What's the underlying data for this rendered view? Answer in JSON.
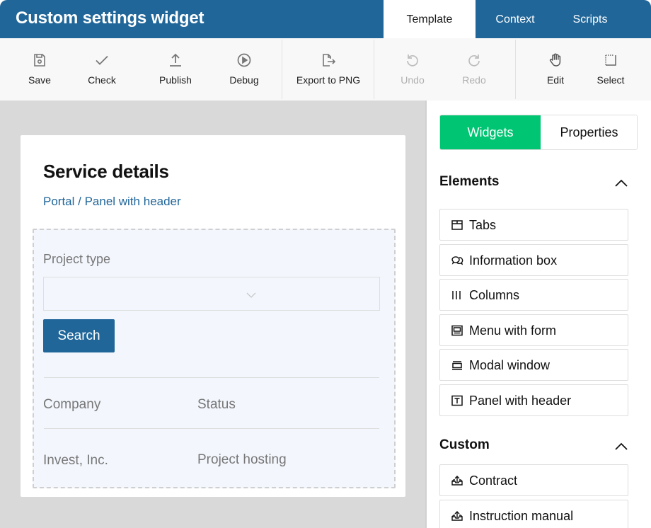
{
  "header": {
    "title": "Custom settings widget",
    "tabs": [
      {
        "label": "Template",
        "active": true
      },
      {
        "label": "Context",
        "active": false
      },
      {
        "label": "Scripts",
        "active": false
      }
    ]
  },
  "toolbar": {
    "items": [
      {
        "label": "Save",
        "icon": "save-icon",
        "enabled": true
      },
      {
        "label": "Check",
        "icon": "check-icon",
        "enabled": true
      },
      {
        "label": "Publish",
        "icon": "upload-icon",
        "enabled": true
      },
      {
        "label": "Debug",
        "icon": "play-circle-icon",
        "enabled": true
      },
      {
        "label": "Export to PNG",
        "icon": "export-icon",
        "enabled": true
      },
      {
        "label": "Undo",
        "icon": "undo-icon",
        "enabled": false
      },
      {
        "label": "Redo",
        "icon": "redo-icon",
        "enabled": false
      },
      {
        "label": "Edit",
        "icon": "hand-icon",
        "enabled": true
      },
      {
        "label": "Select",
        "icon": "select-area-icon",
        "enabled": true
      }
    ]
  },
  "canvas": {
    "panel_title": "Service details",
    "breadcrumb": "Portal / Panel with header",
    "form": {
      "field_label": "Project type",
      "select_value": "",
      "search_button": "Search"
    },
    "table": {
      "columns": [
        "Company",
        "Status"
      ],
      "rows": [
        [
          "Invest, Inc.",
          "Project hosting"
        ]
      ]
    }
  },
  "sidebar": {
    "tabs": [
      {
        "label": "Widgets",
        "active": true
      },
      {
        "label": "Properties",
        "active": false
      }
    ],
    "sections": [
      {
        "title": "Elements",
        "expanded": true,
        "items": [
          {
            "label": "Tabs",
            "icon": "tabs-icon"
          },
          {
            "label": "Information box",
            "icon": "chat-bubbles-icon"
          },
          {
            "label": "Columns",
            "icon": "columns-icon"
          },
          {
            "label": "Menu with form",
            "icon": "menu-form-icon"
          },
          {
            "label": "Modal window",
            "icon": "modal-window-icon"
          },
          {
            "label": "Panel with header",
            "icon": "text-panel-icon"
          }
        ]
      },
      {
        "title": "Custom",
        "expanded": true,
        "items": [
          {
            "label": "Contract",
            "icon": "tray-upload-icon"
          },
          {
            "label": "Instruction manual",
            "icon": "tray-upload-icon"
          }
        ]
      }
    ]
  },
  "colors": {
    "header_bg": "#216699",
    "accent_green": "#00c573",
    "link_blue": "#216699",
    "canvas_bg": "#d9d9d9",
    "dropzone_bg": "#f3f7fd"
  }
}
